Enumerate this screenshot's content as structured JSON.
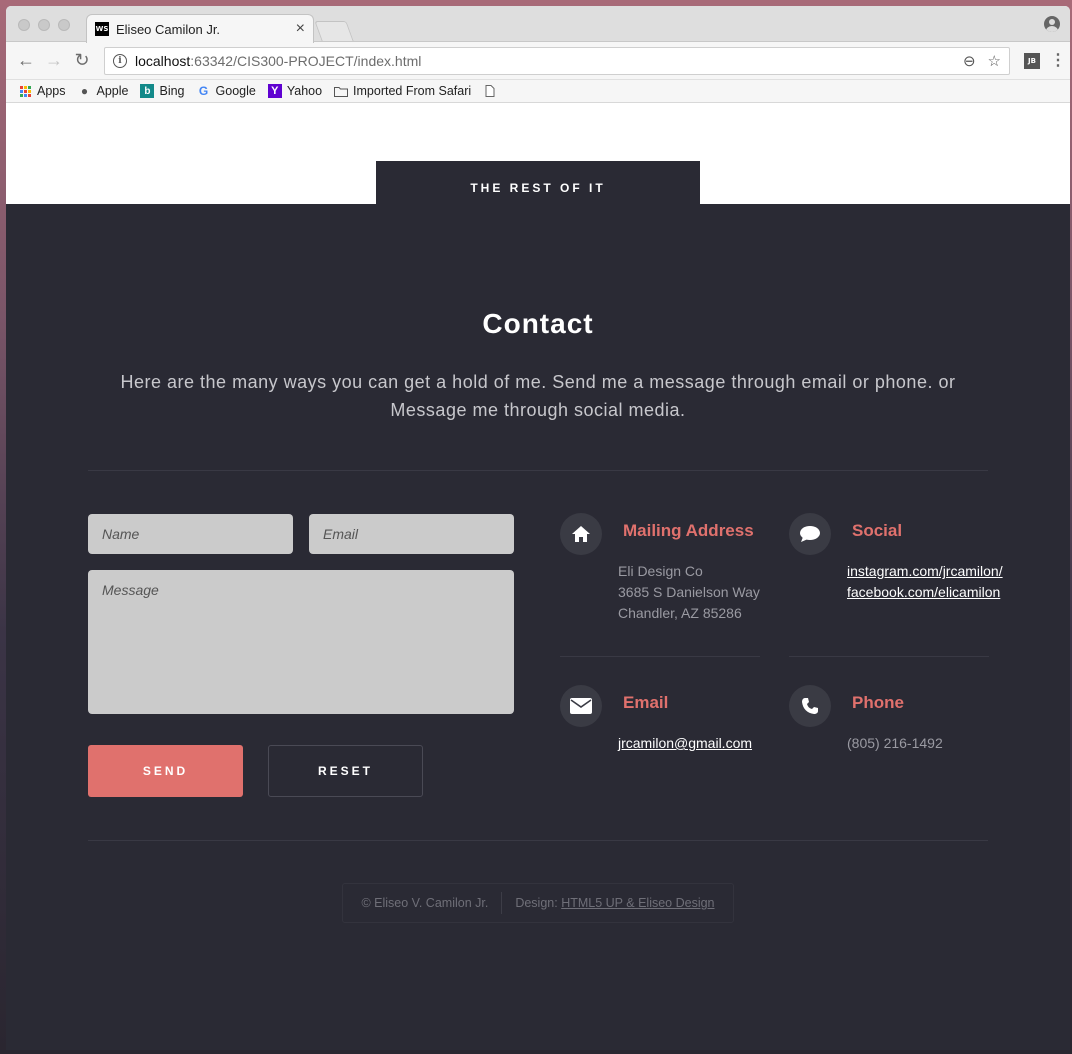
{
  "browser": {
    "tab_title": "Eliseo Camilon Jr.",
    "tab_favicon": "WS",
    "url_host": "localhost",
    "url_path": ":63342/CIS300-PROJECT/index.html",
    "extension_label": "JB"
  },
  "bookmarks": [
    {
      "label": "Apps",
      "icon": "apps-grid-icon"
    },
    {
      "label": "Apple",
      "icon": "apple-icon"
    },
    {
      "label": "Bing",
      "icon": "bing-icon"
    },
    {
      "label": "Google",
      "icon": "google-icon"
    },
    {
      "label": "Yahoo",
      "icon": "yahoo-icon"
    },
    {
      "label": "Imported From Safari",
      "icon": "folder-icon"
    }
  ],
  "page": {
    "section_tab": "THE REST OF IT",
    "title": "Contact",
    "subtitle": "Here are the many ways you can get a hold of me. Send me a message through email or phone. or Message me through social media.",
    "form": {
      "name_placeholder": "Name",
      "email_placeholder": "Email",
      "message_placeholder": "Message",
      "send_label": "SEND",
      "reset_label": "RESET"
    },
    "mailing": {
      "title": "Mailing Address",
      "line1": "Eli Design Co",
      "line2": "3685 S Danielson Way",
      "line3": "Chandler, AZ 85286"
    },
    "social": {
      "title": "Social",
      "link1": "instagram.com/jrcamilon/",
      "link2": "facebook.com/elicamilon"
    },
    "email": {
      "title": "Email",
      "address": "jrcamilon@gmail.com"
    },
    "phone": {
      "title": "Phone",
      "number": "(805) 216-1492"
    },
    "footer": {
      "copyright": "© Eliseo V. Camilon Jr.",
      "design_label": "Design:",
      "design_link": "HTML5 UP & Eliseo Design"
    }
  },
  "colors": {
    "accent": "#e0716d",
    "dark_bg": "#2a2a34"
  }
}
